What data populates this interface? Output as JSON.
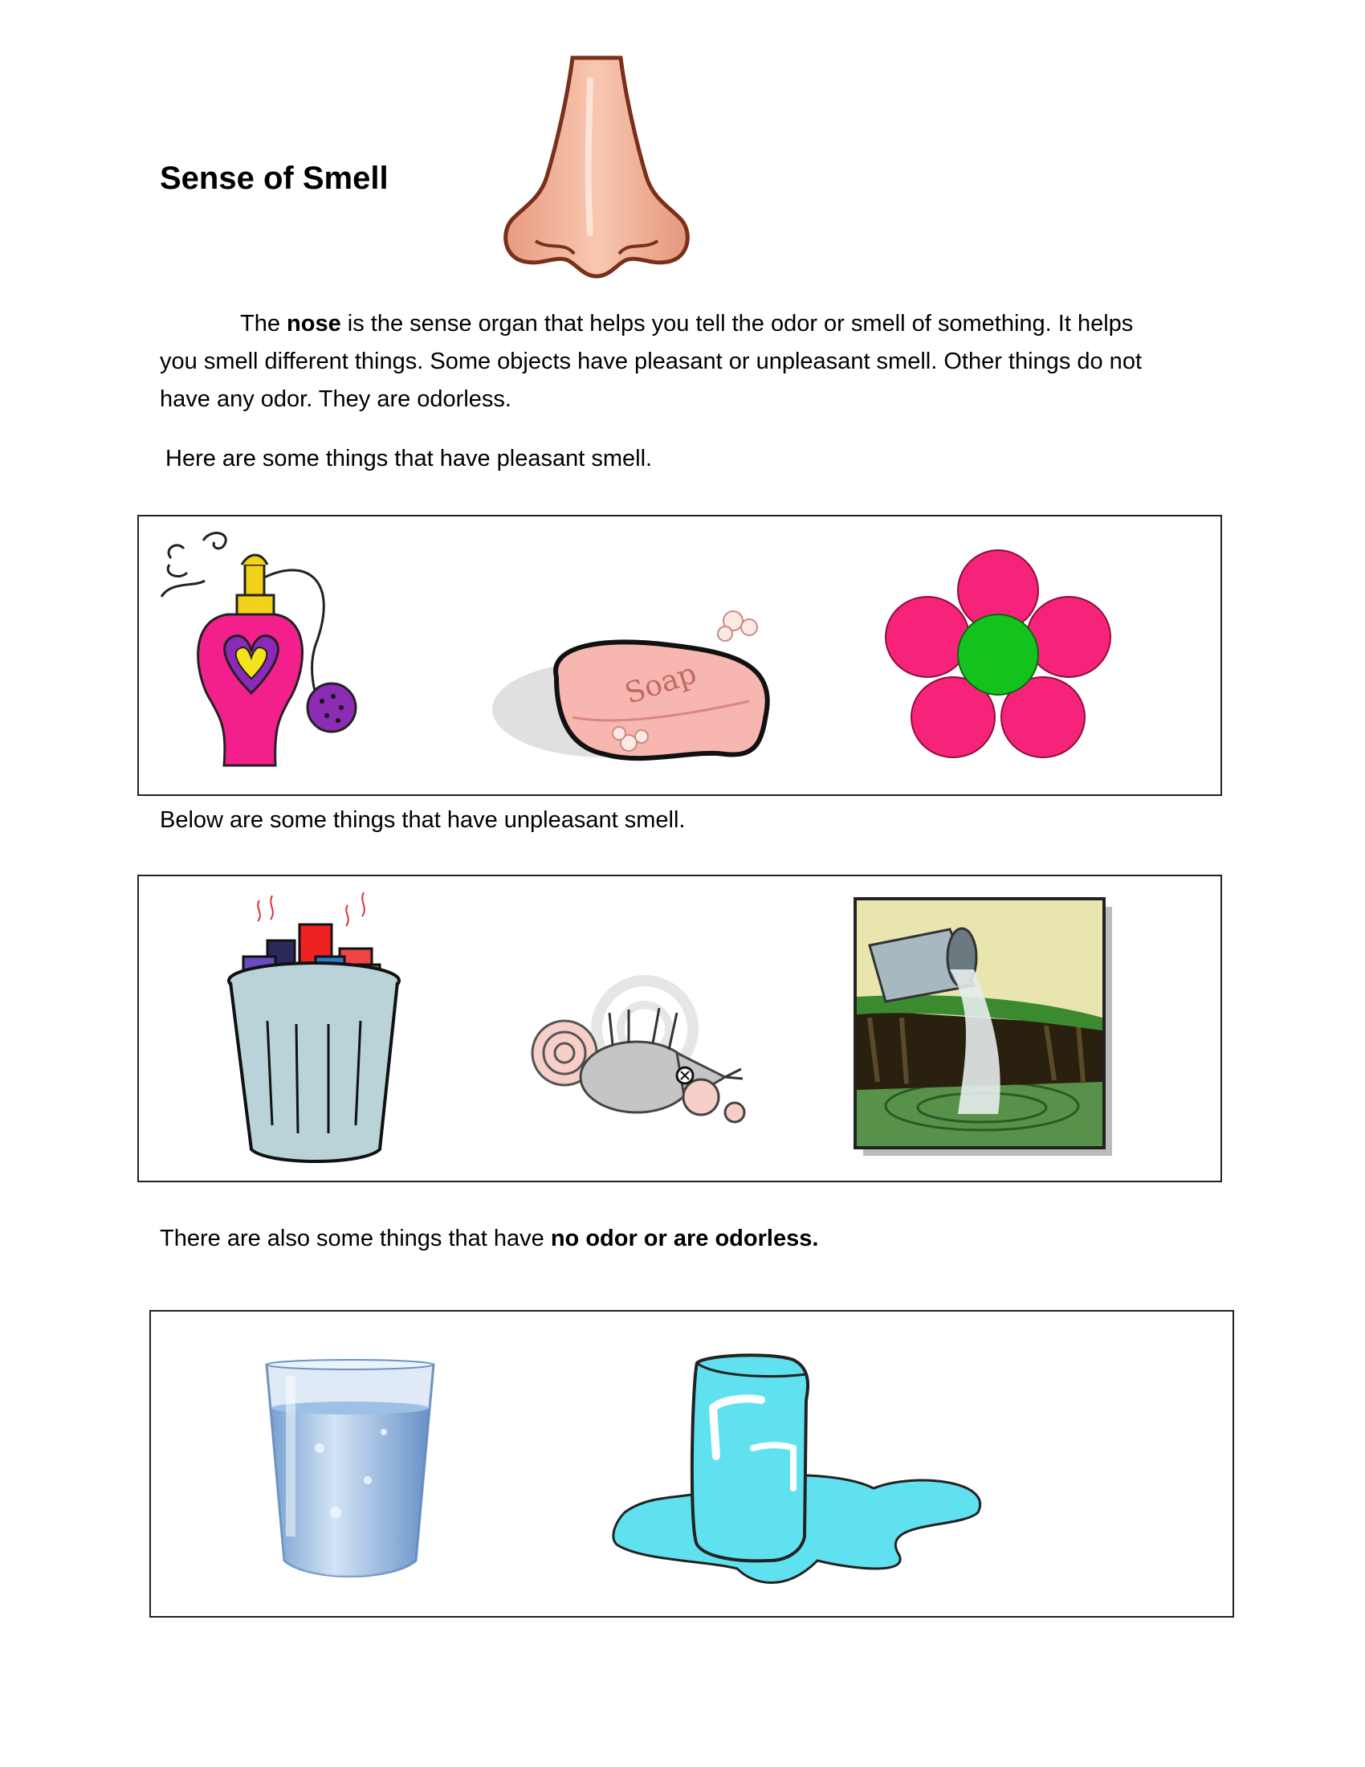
{
  "title": "Sense of Smell",
  "intro": {
    "line1_before": "The ",
    "line1_bold": "nose",
    "line1_after": " is the sense organ that helps you tell the odor or smell of something. It helps",
    "line2": "you smell different things. Some objects have pleasant or unpleasant smell. Other things do not",
    "line3": "have any odor. They are odorless."
  },
  "pleasant_caption": "Here are some things that have pleasant smell.",
  "unpleasant_caption": "Below are some things that have unpleasant smell.",
  "odorless_caption": {
    "before": "There are also some things that have ",
    "bold": "no odor or are odorless."
  },
  "soap_label": "Soap",
  "icons": {
    "header": "nose-icon",
    "pleasant": [
      "perfume-bottle-icon",
      "soap-icon",
      "flower-icon"
    ],
    "unpleasant": [
      "trash-can-icon",
      "dead-mouse-icon",
      "sewage-pipe-icon"
    ],
    "odorless": [
      "water-glass-icon",
      "ice-cube-icon"
    ]
  },
  "colors": {
    "nose": "#f2b49a",
    "flower_petal": "#f7237a",
    "flower_center": "#14c21e",
    "soap": "#f7b6b0",
    "trash_can": "#b9d3d9",
    "water": "#a8cdee",
    "ice": "#5fe1ef"
  }
}
